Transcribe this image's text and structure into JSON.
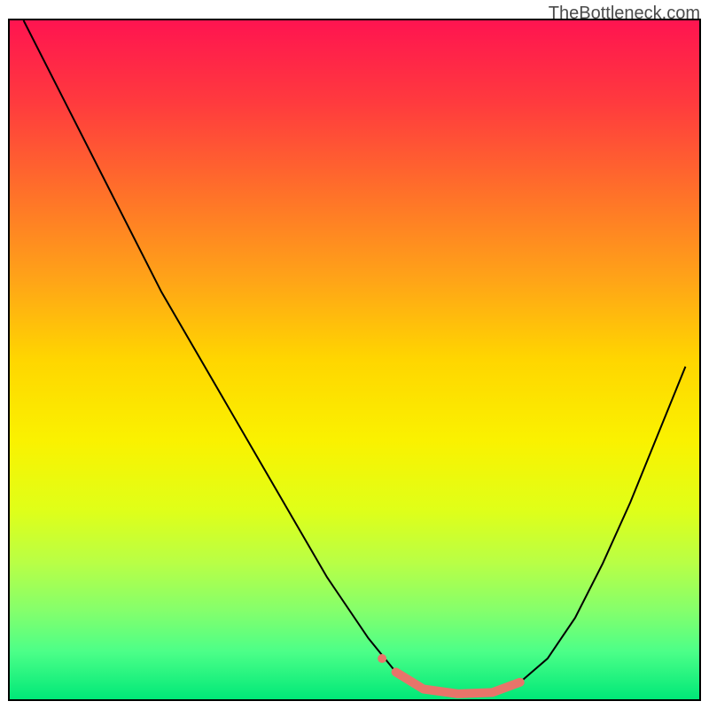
{
  "watermark": "TheBottleneck.com",
  "chart_data": {
    "type": "line",
    "title": "",
    "xlabel": "",
    "ylabel": "",
    "xlim": [
      0,
      100
    ],
    "ylim": [
      0,
      100
    ],
    "background_gradient": {
      "stops": [
        {
          "offset": 0,
          "color": "#ff1450"
        },
        {
          "offset": 12,
          "color": "#ff3a3e"
        },
        {
          "offset": 25,
          "color": "#ff6f2a"
        },
        {
          "offset": 38,
          "color": "#ffa318"
        },
        {
          "offset": 50,
          "color": "#ffd600"
        },
        {
          "offset": 62,
          "color": "#faf200"
        },
        {
          "offset": 72,
          "color": "#e0ff18"
        },
        {
          "offset": 80,
          "color": "#b8ff46"
        },
        {
          "offset": 87,
          "color": "#84ff6c"
        },
        {
          "offset": 93,
          "color": "#4cff88"
        },
        {
          "offset": 100,
          "color": "#00e878"
        }
      ]
    },
    "series": [
      {
        "name": "curve",
        "color": "#000000",
        "stroke_width": 2,
        "points": [
          {
            "x": 2,
            "y": 100
          },
          {
            "x": 8,
            "y": 88
          },
          {
            "x": 15,
            "y": 74
          },
          {
            "x": 22,
            "y": 60
          },
          {
            "x": 30,
            "y": 46
          },
          {
            "x": 38,
            "y": 32
          },
          {
            "x": 46,
            "y": 18
          },
          {
            "x": 52,
            "y": 9
          },
          {
            "x": 56,
            "y": 4
          },
          {
            "x": 60,
            "y": 1.5
          },
          {
            "x": 65,
            "y": 0.8
          },
          {
            "x": 70,
            "y": 1
          },
          {
            "x": 74,
            "y": 2.5
          },
          {
            "x": 78,
            "y": 6
          },
          {
            "x": 82,
            "y": 12
          },
          {
            "x": 86,
            "y": 20
          },
          {
            "x": 90,
            "y": 29
          },
          {
            "x": 94,
            "y": 39
          },
          {
            "x": 98,
            "y": 49
          }
        ]
      },
      {
        "name": "highlight",
        "color": "#e8746a",
        "stroke_width": 10,
        "points": [
          {
            "x": 56,
            "y": 4
          },
          {
            "x": 60,
            "y": 1.5
          },
          {
            "x": 65,
            "y": 0.8
          },
          {
            "x": 70,
            "y": 1
          },
          {
            "x": 74,
            "y": 2.5
          }
        ]
      },
      {
        "name": "highlight-dot",
        "color": "#e8746a",
        "type": "dot",
        "radius": 5,
        "points": [
          {
            "x": 54,
            "y": 6
          }
        ]
      }
    ]
  }
}
